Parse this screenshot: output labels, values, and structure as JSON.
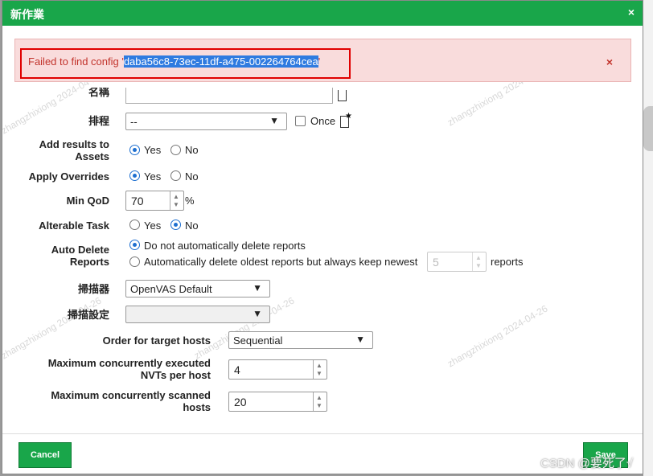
{
  "dialog": {
    "title": "新作業",
    "close_glyph": "×"
  },
  "error": {
    "prefix": "Failed to find config '",
    "selected_id": "daba56c8-73ec-11df-a475-002264764cea",
    "suffix": "'",
    "close_glyph": "×"
  },
  "watermark": {
    "text": "zhangzhixiong 2024-04-26"
  },
  "form": {
    "hidden_label": "名稱",
    "schedule": {
      "label": "排程",
      "value": "--",
      "once_label": "Once"
    },
    "add_assets": {
      "label_line1": "Add results to",
      "label_line2": "Assets",
      "yes": "Yes",
      "no": "No",
      "selected": "Yes"
    },
    "apply_overrides": {
      "label": "Apply Overrides",
      "yes": "Yes",
      "no": "No",
      "selected": "Yes"
    },
    "min_qod": {
      "label": "Min QoD",
      "value": "70",
      "unit": "%"
    },
    "alterable": {
      "label": "Alterable Task",
      "yes": "Yes",
      "no": "No",
      "selected": "No"
    },
    "auto_delete": {
      "label_line1": "Auto Delete",
      "label_line2": "Reports",
      "option1": "Do not automatically delete reports",
      "option2": "Automatically delete oldest reports but always keep newest",
      "keep_value": "5",
      "suffix": "reports",
      "selected": "option1"
    },
    "scanner": {
      "label": "掃描器",
      "value": "OpenVAS Default"
    },
    "scan_config": {
      "label": "掃描設定",
      "value": ""
    },
    "order": {
      "label": "Order for target hosts",
      "value": "Sequential"
    },
    "max_nvts": {
      "label_line1": "Maximum concurrently executed",
      "label_line2": "NVTs per host",
      "value": "4"
    },
    "max_hosts": {
      "label_line1": "Maximum concurrently scanned",
      "label_line2": "hosts",
      "value": "20"
    }
  },
  "footer": {
    "cancel_label": "Cancel",
    "save_label": "Save"
  },
  "overlay": {
    "csdn_text": "CSDN @要死了√"
  },
  "spin": {
    "up": "▲",
    "down": "▼"
  },
  "select_arrow": "▼",
  "colors": {
    "header_green": "#19a64a",
    "error_bg": "#f9dcdc",
    "error_text": "#c2332b",
    "error_outline": "#e00000",
    "radio_blue": "#1e6fd0"
  }
}
